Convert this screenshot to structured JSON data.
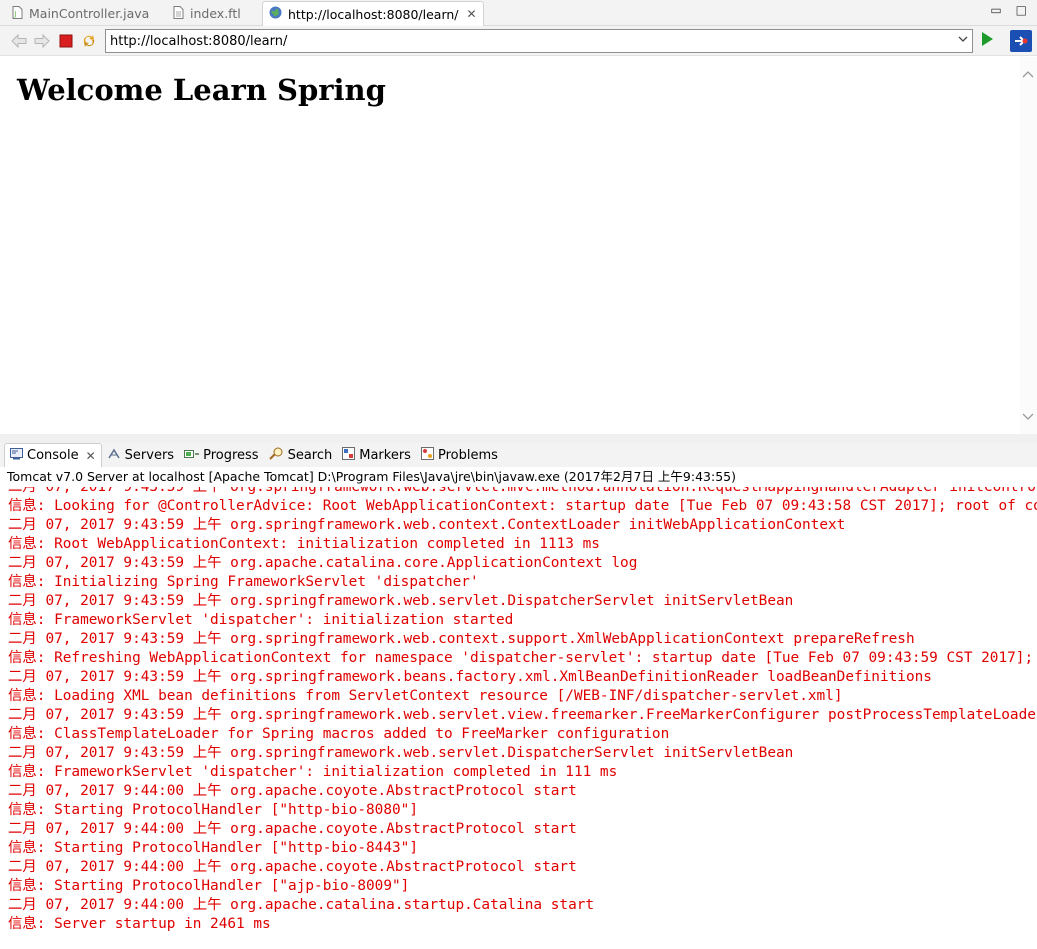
{
  "editor_tabs": [
    {
      "label": "MainController.java"
    },
    {
      "label": "index.ftl"
    },
    {
      "label": "http://localhost:8080/learn/"
    }
  ],
  "tab_close_glyph": "✕",
  "window_buttons": {
    "minimize": "▭",
    "maximize": "□"
  },
  "browser": {
    "url": "http://localhost:8080/learn/",
    "page_heading": "Welcome Learn Spring"
  },
  "view_tabs": [
    {
      "label": "Console",
      "icon": "console-icon"
    },
    {
      "label": "Servers",
      "icon": "servers-icon"
    },
    {
      "label": "Progress",
      "icon": "progress-icon"
    },
    {
      "label": "Search",
      "icon": "search-icon"
    },
    {
      "label": "Markers",
      "icon": "markers-icon"
    },
    {
      "label": "Problems",
      "icon": "problems-icon"
    }
  ],
  "console": {
    "header": "Tomcat v7.0 Server at localhost [Apache Tomcat] D:\\Program Files\\Java\\jre\\bin\\javaw.exe (2017年2月7日 上午9:43:55)",
    "text_color": "#e00000",
    "lines": [
      "二月 07, 2017 9:43:59 上午 org.springframework.web.servlet.mvc.method.annotation.RequestMappingHandlerAdapter initControllerAdviceCache",
      "信息: Looking for @ControllerAdvice: Root WebApplicationContext: startup date [Tue Feb 07 09:43:58 CST 2017]; root of context hierarchy",
      "二月 07, 2017 9:43:59 上午 org.springframework.web.context.ContextLoader initWebApplicationContext",
      "信息: Root WebApplicationContext: initialization completed in 1113 ms",
      "二月 07, 2017 9:43:59 上午 org.apache.catalina.core.ApplicationContext log",
      "信息: Initializing Spring FrameworkServlet 'dispatcher'",
      "二月 07, 2017 9:43:59 上午 org.springframework.web.servlet.DispatcherServlet initServletBean",
      "信息: FrameworkServlet 'dispatcher': initialization started",
      "二月 07, 2017 9:43:59 上午 org.springframework.web.context.support.XmlWebApplicationContext prepareRefresh",
      "信息: Refreshing WebApplicationContext for namespace 'dispatcher-servlet': startup date [Tue Feb 07 09:43:59 CST 2017]; parent: Root WebApplicationContext",
      "二月 07, 2017 9:43:59 上午 org.springframework.beans.factory.xml.XmlBeanDefinitionReader loadBeanDefinitions",
      "信息: Loading XML bean definitions from ServletContext resource [/WEB-INF/dispatcher-servlet.xml]",
      "二月 07, 2017 9:43:59 上午 org.springframework.web.servlet.view.freemarker.FreeMarkerConfigurer postProcessTemplateLoaders",
      "信息: ClassTemplateLoader for Spring macros added to FreeMarker configuration",
      "二月 07, 2017 9:43:59 上午 org.springframework.web.servlet.DispatcherServlet initServletBean",
      "信息: FrameworkServlet 'dispatcher': initialization completed in 111 ms",
      "二月 07, 2017 9:44:00 上午 org.apache.coyote.AbstractProtocol start",
      "信息: Starting ProtocolHandler [\"http-bio-8080\"]",
      "二月 07, 2017 9:44:00 上午 org.apache.coyote.AbstractProtocol start",
      "信息: Starting ProtocolHandler [\"http-bio-8443\"]",
      "二月 07, 2017 9:44:00 上午 org.apache.coyote.AbstractProtocol start",
      "信息: Starting ProtocolHandler [\"ajp-bio-8009\"]",
      "二月 07, 2017 9:44:00 上午 org.apache.catalina.startup.Catalina start",
      "信息: Server startup in 2461 ms"
    ]
  }
}
